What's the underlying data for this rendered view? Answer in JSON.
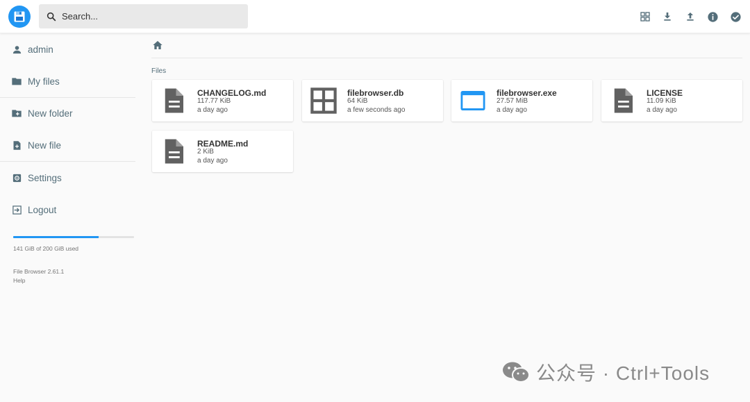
{
  "header": {
    "search_placeholder": "Search...",
    "buttons": [
      "view-grid-icon",
      "download-icon",
      "upload-icon",
      "info-icon",
      "select-check-icon"
    ]
  },
  "sidebar": {
    "items": [
      {
        "label": "admin",
        "icon": "person-icon"
      },
      {
        "label": "My files",
        "icon": "folder-icon"
      },
      {
        "label": "New folder",
        "icon": "new-folder-icon"
      },
      {
        "label": "New file",
        "icon": "new-file-icon"
      },
      {
        "label": "Settings",
        "icon": "settings-icon"
      },
      {
        "label": "Logout",
        "icon": "logout-icon"
      }
    ],
    "usage": {
      "text": "141 GiB of 200 GiB used",
      "used_fraction": 0.705
    },
    "version": "File Browser 2.61.1",
    "help": "Help"
  },
  "main": {
    "section_title": "Files",
    "files": [
      {
        "name": "CHANGELOG.md",
        "size": "117.77 KiB",
        "modified": "a day ago",
        "icon": "document-icon"
      },
      {
        "name": "filebrowser.db",
        "size": "64 KiB",
        "modified": "a few seconds ago",
        "icon": "database-grid-icon"
      },
      {
        "name": "filebrowser.exe",
        "size": "27.57 MiB",
        "modified": "a day ago",
        "icon": "application-window-icon"
      },
      {
        "name": "LICENSE",
        "size": "11.09 KiB",
        "modified": "a day ago",
        "icon": "document-icon"
      },
      {
        "name": "README.md",
        "size": "2 KiB",
        "modified": "a day ago",
        "icon": "document-icon"
      }
    ]
  },
  "watermark": {
    "text": "公众号 · Ctrl+Tools"
  },
  "colors": {
    "accent": "#2196f3",
    "icon_gray": "#546e7a",
    "doc_gray": "#616161"
  }
}
